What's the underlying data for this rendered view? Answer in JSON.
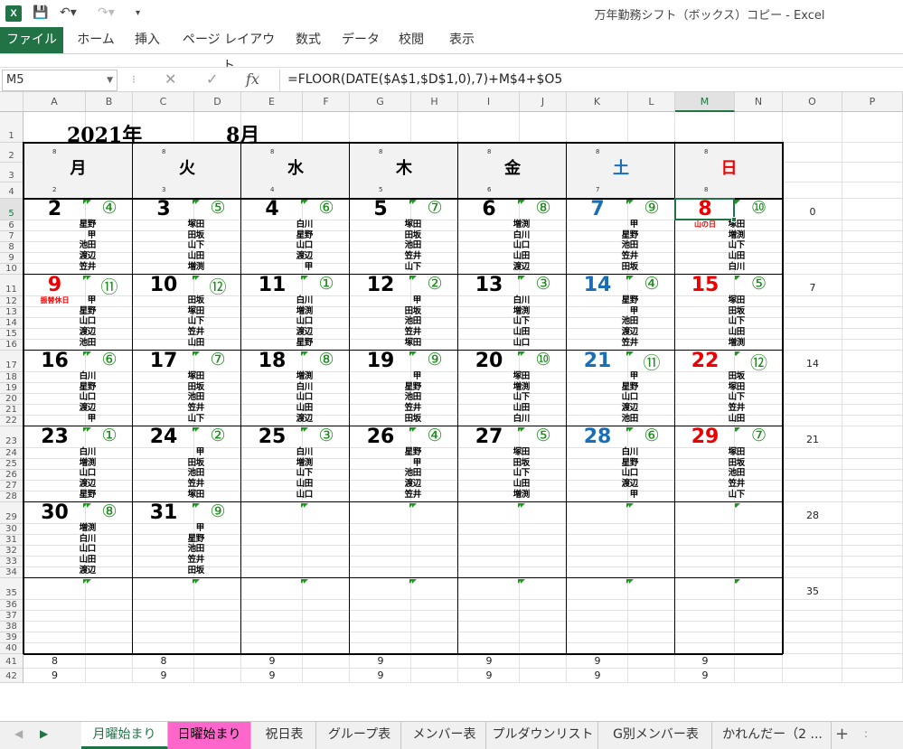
{
  "app": {
    "window_title": "万年勤務シフト（ボックス）コピー - Excel",
    "logo": "X"
  },
  "ribbon": {
    "file": "ファイル",
    "tabs": [
      "ホーム",
      "挿入",
      "ページ レイアウト",
      "数式",
      "データ",
      "校閲",
      "表示"
    ]
  },
  "formula_bar": {
    "name_box": "M5",
    "formula": "=FLOOR(DATE($A$1,$D$1,0),7)+M$4+$O5"
  },
  "columns": [
    "A",
    "B",
    "C",
    "D",
    "E",
    "F",
    "G",
    "H",
    "I",
    "J",
    "K",
    "L",
    "M",
    "N",
    "O",
    "P"
  ],
  "selected_col": "M",
  "rows": [
    "1",
    "2",
    "3",
    "4",
    "5",
    "6",
    "7",
    "8",
    "9",
    "10",
    "11",
    "12",
    "13",
    "14",
    "15",
    "16",
    "17",
    "18",
    "19",
    "20",
    "21",
    "22",
    "23",
    "24",
    "25",
    "26",
    "27",
    "28",
    "29",
    "30",
    "31",
    "32",
    "33",
    "34",
    "35",
    "36",
    "37",
    "38",
    "39",
    "40",
    "41",
    "42"
  ],
  "selected_row": "5",
  "calendar": {
    "year": "2021年",
    "month": "8月",
    "weekdays": [
      {
        "name": "月",
        "top": "8",
        "bottom": "2",
        "color": "black"
      },
      {
        "name": "火",
        "top": "8",
        "bottom": "3",
        "color": "black"
      },
      {
        "name": "水",
        "top": "8",
        "bottom": "4",
        "color": "black"
      },
      {
        "name": "木",
        "top": "8",
        "bottom": "5",
        "color": "black"
      },
      {
        "name": "金",
        "top": "8",
        "bottom": "6",
        "color": "black"
      },
      {
        "name": "土",
        "top": "8",
        "bottom": "7",
        "color": "blue"
      },
      {
        "name": "日",
        "top": "8",
        "bottom": "8",
        "color": "red"
      }
    ],
    "side_numbers": [
      "0",
      "7",
      "14",
      "21",
      "28",
      "35"
    ],
    "weeks": [
      [
        {
          "date": "2",
          "color": "black",
          "circ": "④",
          "holiday": "",
          "names": [
            "星野",
            "甲",
            "池田",
            "渡辺",
            "笠井"
          ]
        },
        {
          "date": "3",
          "color": "black",
          "circ": "⑤",
          "holiday": "",
          "names": [
            "塚田",
            "田坂",
            "山下",
            "山田",
            "増渕"
          ]
        },
        {
          "date": "4",
          "color": "black",
          "circ": "⑥",
          "holiday": "",
          "names": [
            "白川",
            "星野",
            "山口",
            "渡辺",
            "甲"
          ]
        },
        {
          "date": "5",
          "color": "black",
          "circ": "⑦",
          "holiday": "",
          "names": [
            "塚田",
            "田坂",
            "池田",
            "笠井",
            "山下"
          ]
        },
        {
          "date": "6",
          "color": "black",
          "circ": "⑧",
          "holiday": "",
          "names": [
            "増渕",
            "白川",
            "山口",
            "山田",
            "渡辺"
          ]
        },
        {
          "date": "7",
          "color": "blue",
          "circ": "⑨",
          "holiday": "",
          "names": [
            "甲",
            "星野",
            "池田",
            "笠井",
            "田坂"
          ]
        },
        {
          "date": "8",
          "color": "red",
          "circ": "⑩",
          "holiday": "山の日",
          "names": [
            "塚田",
            "増渕",
            "山下",
            "山田",
            "白川"
          ]
        }
      ],
      [
        {
          "date": "9",
          "color": "red",
          "circ": "⑪",
          "holiday": "振替休日",
          "names": [
            "甲",
            "星野",
            "山口",
            "渡辺",
            "池田"
          ]
        },
        {
          "date": "10",
          "color": "black",
          "circ": "⑫",
          "holiday": "",
          "names": [
            "田坂",
            "塚田",
            "山下",
            "笠井",
            "山田"
          ]
        },
        {
          "date": "11",
          "color": "black",
          "circ": "①",
          "holiday": "",
          "names": [
            "白川",
            "増渕",
            "山口",
            "渡辺",
            "星野"
          ]
        },
        {
          "date": "12",
          "color": "black",
          "circ": "②",
          "holiday": "",
          "names": [
            "甲",
            "田坂",
            "池田",
            "笠井",
            "塚田"
          ]
        },
        {
          "date": "13",
          "color": "black",
          "circ": "③",
          "holiday": "",
          "names": [
            "白川",
            "増渕",
            "山下",
            "山田",
            "山口"
          ]
        },
        {
          "date": "14",
          "color": "blue",
          "circ": "④",
          "holiday": "",
          "names": [
            "星野",
            "甲",
            "池田",
            "渡辺",
            "笠井"
          ]
        },
        {
          "date": "15",
          "color": "red",
          "circ": "⑤",
          "holiday": "",
          "names": [
            "塚田",
            "田坂",
            "山下",
            "山田",
            "増渕"
          ]
        }
      ],
      [
        {
          "date": "16",
          "color": "black",
          "circ": "⑥",
          "holiday": "",
          "names": [
            "白川",
            "星野",
            "山口",
            "渡辺",
            "甲"
          ]
        },
        {
          "date": "17",
          "color": "black",
          "circ": "⑦",
          "holiday": "",
          "names": [
            "塚田",
            "田坂",
            "池田",
            "笠井",
            "山下"
          ]
        },
        {
          "date": "18",
          "color": "black",
          "circ": "⑧",
          "holiday": "",
          "names": [
            "増渕",
            "白川",
            "山口",
            "山田",
            "渡辺"
          ]
        },
        {
          "date": "19",
          "color": "black",
          "circ": "⑨",
          "holiday": "",
          "names": [
            "甲",
            "星野",
            "池田",
            "笠井",
            "田坂"
          ]
        },
        {
          "date": "20",
          "color": "black",
          "circ": "⑩",
          "holiday": "",
          "names": [
            "塚田",
            "増渕",
            "山下",
            "山田",
            "白川"
          ]
        },
        {
          "date": "21",
          "color": "blue",
          "circ": "⑪",
          "holiday": "",
          "names": [
            "甲",
            "星野",
            "山口",
            "渡辺",
            "池田"
          ]
        },
        {
          "date": "22",
          "color": "red",
          "circ": "⑫",
          "holiday": "",
          "names": [
            "田坂",
            "塚田",
            "山下",
            "笠井",
            "山田"
          ]
        }
      ],
      [
        {
          "date": "23",
          "color": "black",
          "circ": "①",
          "holiday": "",
          "names": [
            "白川",
            "増渕",
            "山口",
            "渡辺",
            "星野"
          ]
        },
        {
          "date": "24",
          "color": "black",
          "circ": "②",
          "holiday": "",
          "names": [
            "甲",
            "田坂",
            "池田",
            "笠井",
            "塚田"
          ]
        },
        {
          "date": "25",
          "color": "black",
          "circ": "③",
          "holiday": "",
          "names": [
            "白川",
            "増渕",
            "山下",
            "山田",
            "山口"
          ]
        },
        {
          "date": "26",
          "color": "black",
          "circ": "④",
          "holiday": "",
          "names": [
            "星野",
            "甲",
            "池田",
            "渡辺",
            "笠井"
          ]
        },
        {
          "date": "27",
          "color": "black",
          "circ": "⑤",
          "holiday": "",
          "names": [
            "塚田",
            "田坂",
            "山下",
            "山田",
            "増渕"
          ]
        },
        {
          "date": "28",
          "color": "blue",
          "circ": "⑥",
          "holiday": "",
          "names": [
            "白川",
            "星野",
            "山口",
            "渡辺",
            "甲"
          ]
        },
        {
          "date": "29",
          "color": "red",
          "circ": "⑦",
          "holiday": "",
          "names": [
            "塚田",
            "田坂",
            "池田",
            "笠井",
            "山下"
          ]
        }
      ],
      [
        {
          "date": "30",
          "color": "black",
          "circ": "⑧",
          "holiday": "",
          "names": [
            "増渕",
            "白川",
            "山口",
            "山田",
            "渡辺"
          ]
        },
        {
          "date": "31",
          "color": "black",
          "circ": "⑨",
          "holiday": "",
          "names": [
            "甲",
            "星野",
            "池田",
            "笠井",
            "田坂"
          ]
        },
        {
          "date": "",
          "color": "black",
          "circ": "",
          "holiday": "",
          "names": []
        },
        {
          "date": "",
          "color": "black",
          "circ": "",
          "holiday": "",
          "names": []
        },
        {
          "date": "",
          "color": "black",
          "circ": "",
          "holiday": "",
          "names": []
        },
        {
          "date": "",
          "color": "black",
          "circ": "",
          "holiday": "",
          "names": []
        },
        {
          "date": "",
          "color": "black",
          "circ": "",
          "holiday": "",
          "names": []
        }
      ],
      [
        {
          "date": "",
          "color": "black",
          "circ": "",
          "holiday": "",
          "names": []
        },
        {
          "date": "",
          "color": "black",
          "circ": "",
          "holiday": "",
          "names": []
        },
        {
          "date": "",
          "color": "black",
          "circ": "",
          "holiday": "",
          "names": []
        },
        {
          "date": "",
          "color": "black",
          "circ": "",
          "holiday": "",
          "names": []
        },
        {
          "date": "",
          "color": "black",
          "circ": "",
          "holiday": "",
          "names": []
        },
        {
          "date": "",
          "color": "black",
          "circ": "",
          "holiday": "",
          "names": []
        },
        {
          "date": "",
          "color": "black",
          "circ": "",
          "holiday": "",
          "names": []
        }
      ]
    ],
    "row41": [
      "8",
      "8",
      "9",
      "9",
      "9",
      "9",
      "9"
    ],
    "row42": [
      "9",
      "9",
      "9",
      "9",
      "9",
      "9",
      "9"
    ]
  },
  "sheet_tabs": [
    {
      "label": "月曜始まり",
      "state": "active"
    },
    {
      "label": "日曜始まり",
      "state": "pink"
    },
    {
      "label": "祝日表",
      "state": "normal"
    },
    {
      "label": "グループ表",
      "state": "normal"
    },
    {
      "label": "メンバー表",
      "state": "normal"
    },
    {
      "label": "プルダウンリスト",
      "state": "normal"
    },
    {
      "label": "G別メンバー表",
      "state": "normal"
    },
    {
      "label": "かれんだー（2 ...",
      "state": "normal"
    }
  ],
  "icons": {
    "save": "save-icon",
    "undo": "undo-icon",
    "redo": "redo-icon",
    "customize": "customize-icon",
    "cancel": "cancel-icon",
    "enter": "enter-icon",
    "fx": "fx",
    "new_sheet": "+"
  },
  "colors": {
    "excel_green": "#217346",
    "circle_green": "#1a8a1a",
    "saturday_blue": "#1a6eb5",
    "sunday_red": "#ee0000",
    "pink_tab": "#ff66cc"
  }
}
